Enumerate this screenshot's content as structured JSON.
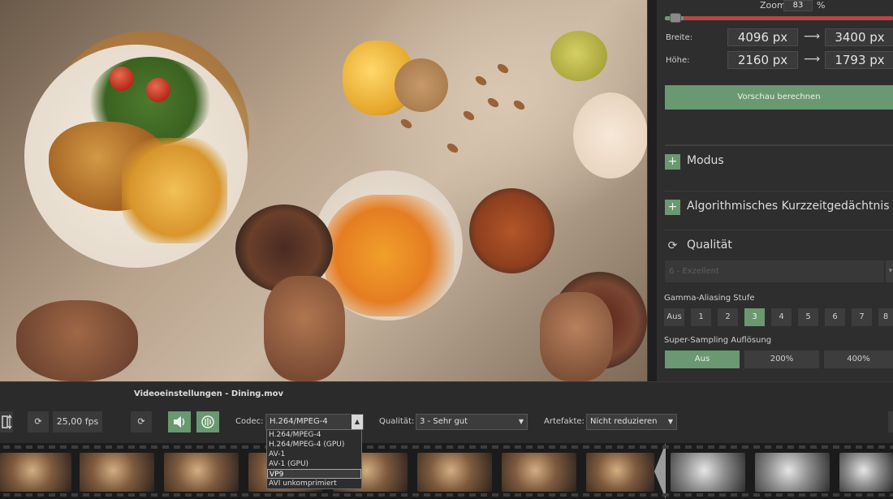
{
  "preview": {
    "alt": ""
  },
  "right_panel": {
    "zoom_label": "Zoom",
    "zoom_value": "83",
    "zoom_unit": "%",
    "zoom_level": 0.08,
    "width_label": "Breite:",
    "width_from": "4096 px",
    "width_to": "3400 px",
    "height_label": "Höhe:",
    "height_from": "2160 px",
    "height_to": "1793 px",
    "arrow": "⟶",
    "preview_button": "Vorschau berechnen",
    "sections": [
      {
        "icon": "plus-icon",
        "glyph": "+",
        "title": "Modus"
      },
      {
        "icon": "plus-icon",
        "glyph": "+",
        "title": "Algorithmisches Kurzzeitgedächtnis"
      },
      {
        "icon": "refresh-icon",
        "glyph": "⟳",
        "title": "Qualität"
      }
    ],
    "quality_select": "6 - Exzellent",
    "gamma_label": "Gamma-Aliasing Stufe",
    "gamma_options": [
      "Aus",
      "1",
      "2",
      "3",
      "4",
      "5",
      "6",
      "7",
      "8"
    ],
    "gamma_selected": "3",
    "supersampling_label": "Super-Sampling Auflösung",
    "supersampling_options": [
      "Aus",
      "200%",
      "400%"
    ],
    "supersampling_selected": "Aus"
  },
  "video_bar": {
    "title": "Videoeinstellungen - Dining.mov",
    "fps": "25,00 fps",
    "codec_label": "Codec:",
    "codec_value": "H.264/MPEG-4",
    "quality_label": "Qualität:",
    "quality_value": "3 - Sehr gut",
    "artifacts_label": "Artefakte:",
    "artifacts_value": "Nicht reduzieren",
    "icons": {
      "resize": "resize-vertical-icon",
      "refresh": "refresh-icon",
      "audio": "speaker-icon",
      "audio_settings": "audio-settings-icon"
    }
  },
  "codec_options": [
    "H.264/MPEG-4",
    "H.264/MPEG-4 (GPU)",
    "AV-1",
    "AV-1 (GPU)",
    "VP9",
    "AVI unkomprimiert"
  ],
  "codec_highlighted": "VP9",
  "filmstrip": {
    "frames_color": 8,
    "frames_gray": 3
  },
  "colors": {
    "accent_green": "#6a9870",
    "panel_bg": "#2e2e2e",
    "zoom_red": "#b94646"
  }
}
